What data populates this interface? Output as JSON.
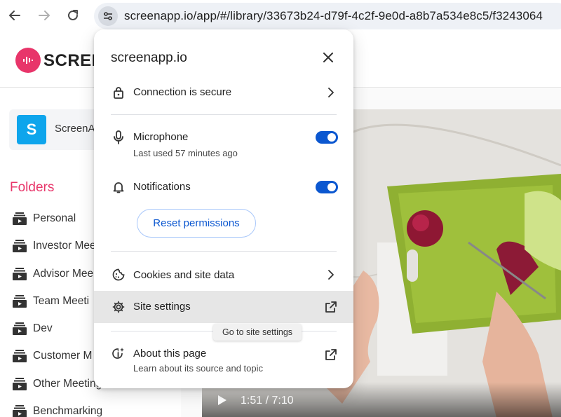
{
  "browser": {
    "url": "screenapp.io/app/#/library/33673b24-d79f-4c2f-9e0d-a8b7a534e8c5/f3243064",
    "icons": {
      "back": "arrow-left-icon",
      "forward": "arrow-right-icon",
      "reload": "reload-icon",
      "site_info": "tune-icon"
    }
  },
  "app": {
    "logo_text": "SCREE",
    "workspace": {
      "initial": "S",
      "name": "ScreenA"
    },
    "folders_title": "Folders",
    "folders": [
      "Personal",
      "Investor Mee",
      "Advisor Mee",
      "Team Meeti",
      "Dev",
      "Customer M",
      "Other Meetings",
      "Benchmarking"
    ],
    "video": {
      "time": "1:51 / 7:10"
    }
  },
  "popup": {
    "title": "screenapp.io",
    "connection": {
      "label": "Connection is secure",
      "icon": "lock-icon"
    },
    "microphone": {
      "label": "Microphone",
      "sublabel": "Last used 57 minutes ago",
      "enabled": true,
      "icon": "microphone-icon"
    },
    "notifications": {
      "label": "Notifications",
      "enabled": true,
      "icon": "bell-icon"
    },
    "reset_label": "Reset permissions",
    "cookies": {
      "label": "Cookies and site data",
      "icon": "cookie-icon"
    },
    "site_settings": {
      "label": "Site settings",
      "icon": "gear-icon"
    },
    "about": {
      "label": "About this page",
      "sublabel": "Learn about its source and topic",
      "icon": "about-sparkle-icon"
    },
    "tooltip": "Go to site settings"
  },
  "colors": {
    "accent_blue": "#0b57d0",
    "brand_pink": "#e8356a",
    "avatar_blue": "#0ea5ec"
  }
}
